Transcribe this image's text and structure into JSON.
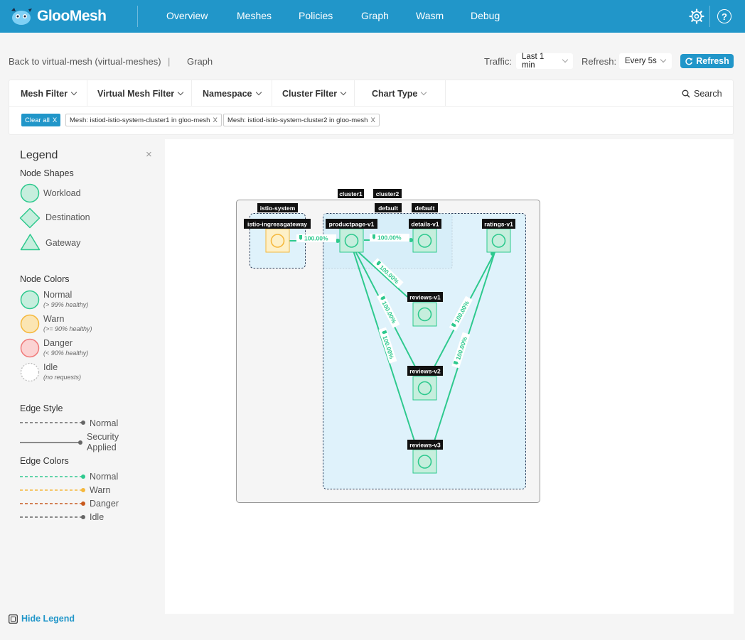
{
  "app": {
    "logo_text": "GlooMesh"
  },
  "nav": {
    "items": [
      {
        "label": "Overview"
      },
      {
        "label": "Meshes"
      },
      {
        "label": "Policies"
      },
      {
        "label": "Graph"
      },
      {
        "label": "Wasm"
      },
      {
        "label": "Debug"
      }
    ],
    "settings_icon": "gear-icon",
    "help_icon": "help-icon",
    "help_glyph": "?"
  },
  "breadcrumb": {
    "back": "Back to virtual-mesh (virtual-meshes)",
    "separator": "|",
    "current": "Graph"
  },
  "controls": {
    "traffic_label": "Traffic:",
    "traffic_value": "Last 1 min",
    "refresh_label": "Refresh:",
    "refresh_value": "Every 5s",
    "refresh_button": "Refresh"
  },
  "filters": {
    "mesh_filter": "Mesh Filter",
    "virtual_mesh_filter": "Virtual Mesh Filter",
    "namespace": "Namespace",
    "cluster_filter": "Cluster Filter",
    "chart_type": "Chart Type",
    "search": "Search",
    "clear_all": "Clear all",
    "chips": [
      {
        "label": "Mesh: istiod-istio-system-cluster1 in gloo-mesh"
      },
      {
        "label": "Mesh: istiod-istio-system-cluster2 in gloo-mesh"
      }
    ],
    "close_glyph": "X"
  },
  "legend": {
    "title": "Legend",
    "close_glyph": "×",
    "node_shapes": {
      "heading": "Node Shapes",
      "workload": "Workload",
      "destination": "Destination",
      "gateway": "Gateway"
    },
    "node_colors": {
      "heading": "Node Colors",
      "normal": "Normal",
      "normal_sub": "(> 99% healthy)",
      "warn": "Warn",
      "warn_sub": "(>= 90% healthy)",
      "danger": "Danger",
      "danger_sub": "(< 90% healthy)",
      "idle": "Idle",
      "idle_sub": "(no requests)"
    },
    "edge_style": {
      "heading": "Edge Style",
      "normal": "Normal",
      "security_1": "Security",
      "security_2": "Applied"
    },
    "edge_colors": {
      "heading": "Edge Colors",
      "normal": "Normal",
      "warn": "Warn",
      "danger": "Danger",
      "idle": "Idle"
    },
    "colors": {
      "normal": "#2ec98e",
      "warn": "#f5b83d",
      "danger": "#f07a7a",
      "danger_edge": "#c85a1e",
      "idle": "#666666"
    }
  },
  "graph": {
    "clusters": {
      "cluster1": "cluster1",
      "cluster2": "cluster2"
    },
    "namespaces": {
      "istio_system": "istio-system",
      "default_1": "default",
      "default_2": "default"
    },
    "nodes": {
      "ingress": "istio-ingressgateway",
      "productpage": "productpage-v1",
      "details": "details-v1",
      "ratings": "ratings-v1",
      "reviews_v1": "reviews-v1",
      "reviews_v2": "reviews-v2",
      "reviews_v3": "reviews-v3"
    },
    "edge_label": "100.00%"
  },
  "footer": {
    "hide_legend": "Hide Legend"
  }
}
